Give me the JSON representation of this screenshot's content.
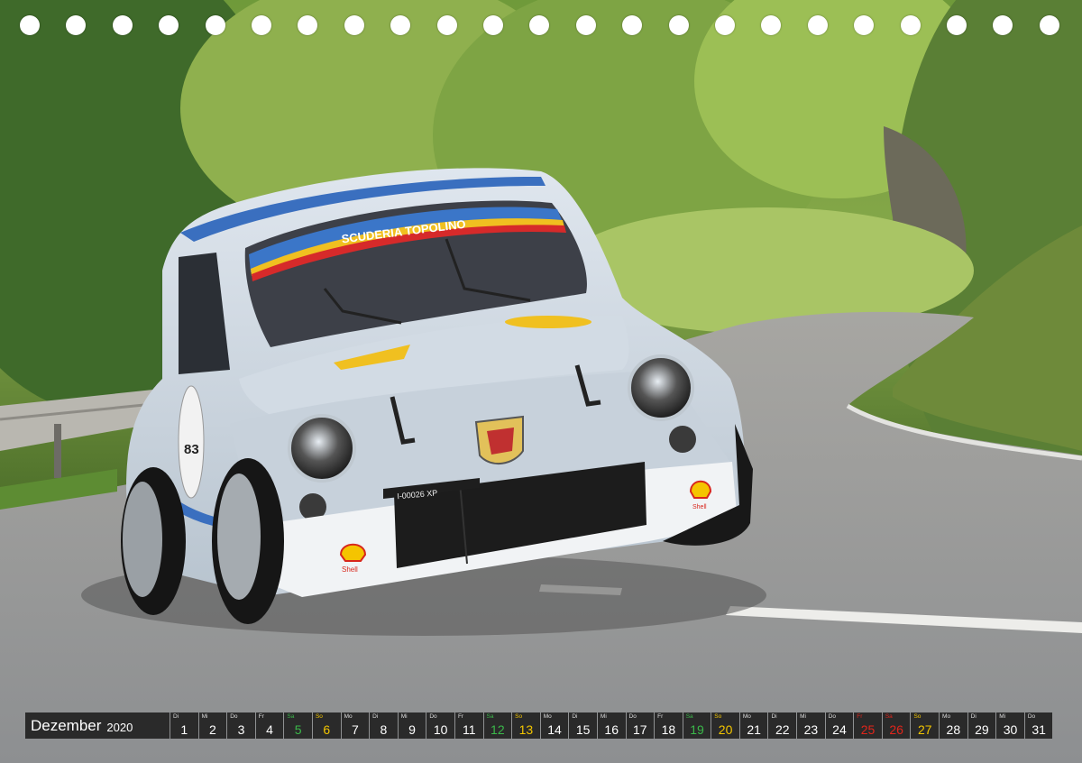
{
  "calendar": {
    "month": "Dezember",
    "year": "2020",
    "days": [
      {
        "wd": "Di",
        "n": "1",
        "t": "w"
      },
      {
        "wd": "Mi",
        "n": "2",
        "t": "w"
      },
      {
        "wd": "Do",
        "n": "3",
        "t": "w"
      },
      {
        "wd": "Fr",
        "n": "4",
        "t": "w"
      },
      {
        "wd": "Sa",
        "n": "5",
        "t": "sat"
      },
      {
        "wd": "So",
        "n": "6",
        "t": "sun"
      },
      {
        "wd": "Mo",
        "n": "7",
        "t": "w"
      },
      {
        "wd": "Di",
        "n": "8",
        "t": "w"
      },
      {
        "wd": "Mi",
        "n": "9",
        "t": "w"
      },
      {
        "wd": "Do",
        "n": "10",
        "t": "w"
      },
      {
        "wd": "Fr",
        "n": "11",
        "t": "w"
      },
      {
        "wd": "Sa",
        "n": "12",
        "t": "sat"
      },
      {
        "wd": "So",
        "n": "13",
        "t": "sun"
      },
      {
        "wd": "Mo",
        "n": "14",
        "t": "w"
      },
      {
        "wd": "Di",
        "n": "15",
        "t": "w"
      },
      {
        "wd": "Mi",
        "n": "16",
        "t": "w"
      },
      {
        "wd": "Do",
        "n": "17",
        "t": "w"
      },
      {
        "wd": "Fr",
        "n": "18",
        "t": "w"
      },
      {
        "wd": "Sa",
        "n": "19",
        "t": "sat"
      },
      {
        "wd": "So",
        "n": "20",
        "t": "sun"
      },
      {
        "wd": "Mo",
        "n": "21",
        "t": "w"
      },
      {
        "wd": "Di",
        "n": "22",
        "t": "w"
      },
      {
        "wd": "Mi",
        "n": "23",
        "t": "w"
      },
      {
        "wd": "Do",
        "n": "24",
        "t": "w"
      },
      {
        "wd": "Fr",
        "n": "25",
        "t": "hol"
      },
      {
        "wd": "Sa",
        "n": "26",
        "t": "hol"
      },
      {
        "wd": "So",
        "n": "27",
        "t": "sun"
      },
      {
        "wd": "Mo",
        "n": "28",
        "t": "w"
      },
      {
        "wd": "Di",
        "n": "29",
        "t": "w"
      },
      {
        "wd": "Mi",
        "n": "30",
        "t": "w"
      },
      {
        "wd": "Do",
        "n": "31",
        "t": "w"
      }
    ]
  },
  "photo": {
    "windshield_banner": "SCUDERIA TOPOLINO",
    "race_number": "83",
    "plate": "I-00026 XP",
    "sponsor": "Shell"
  },
  "colors": {
    "car_body": "#c9d3dd",
    "road": "#8f9294",
    "foliage": "#5e8a2e",
    "calendar_bg": "#2a2a2a",
    "saturday": "#3bb84a",
    "sunday": "#f2c500",
    "holiday": "#e0251b"
  }
}
